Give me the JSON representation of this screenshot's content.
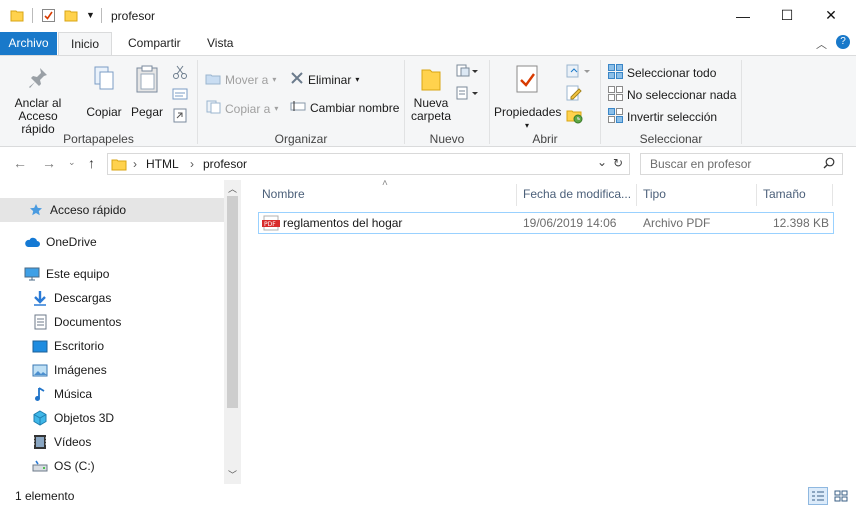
{
  "window": {
    "title": "profesor",
    "buttons": {
      "minimize": "—",
      "maximize": "☐",
      "close": "✕"
    }
  },
  "ribbon": {
    "tabs": [
      "Archivo",
      "Inicio",
      "Compartir",
      "Vista"
    ],
    "portapapeles": {
      "pin_label_1": "Anclar al",
      "pin_label_2": "Acceso rápido",
      "copy": "Copiar",
      "paste": "Pegar",
      "group": "Portapapeles"
    },
    "organizar": {
      "move": "Mover a",
      "copy_to": "Copiar a",
      "delete": "Eliminar",
      "rename": "Cambiar nombre",
      "group": "Organizar"
    },
    "nuevo": {
      "new_folder_1": "Nueva",
      "new_folder_2": "carpeta",
      "group": "Nuevo"
    },
    "abrir": {
      "properties": "Propiedades",
      "group": "Abrir"
    },
    "seleccionar": {
      "select_all": "Seleccionar todo",
      "select_none": "No seleccionar nada",
      "invert": "Invertir selección",
      "group": "Seleccionar"
    }
  },
  "address": {
    "path": [
      "HTML",
      "profesor"
    ],
    "search_placeholder": "Buscar en profesor"
  },
  "navpane": {
    "items": [
      {
        "label": "Acceso rápido",
        "icon": "star-icon"
      },
      {
        "label": "OneDrive",
        "icon": "cloud-icon"
      },
      {
        "label": "Este equipo",
        "icon": "computer-icon"
      },
      {
        "label": "Descargas",
        "icon": "download-icon"
      },
      {
        "label": "Documentos",
        "icon": "document-icon"
      },
      {
        "label": "Escritorio",
        "icon": "desktop-icon"
      },
      {
        "label": "Imágenes",
        "icon": "image-icon"
      },
      {
        "label": "Música",
        "icon": "music-icon"
      },
      {
        "label": "Objetos 3D",
        "icon": "cube-icon"
      },
      {
        "label": "Vídeos",
        "icon": "video-icon"
      },
      {
        "label": "OS (C:)",
        "icon": "drive-icon"
      }
    ]
  },
  "files": {
    "columns": [
      "Nombre",
      "Fecha de modifica...",
      "Tipo",
      "Tamaño"
    ],
    "rows": [
      {
        "name": "reglamentos del hogar",
        "date": "19/06/2019 14:06",
        "type": "Archivo PDF",
        "size": "12.398 KB"
      }
    ]
  },
  "status": {
    "count": "1 elemento"
  },
  "colors": {
    "accent": "#1979ca",
    "selection_border": "#99d1ff"
  }
}
